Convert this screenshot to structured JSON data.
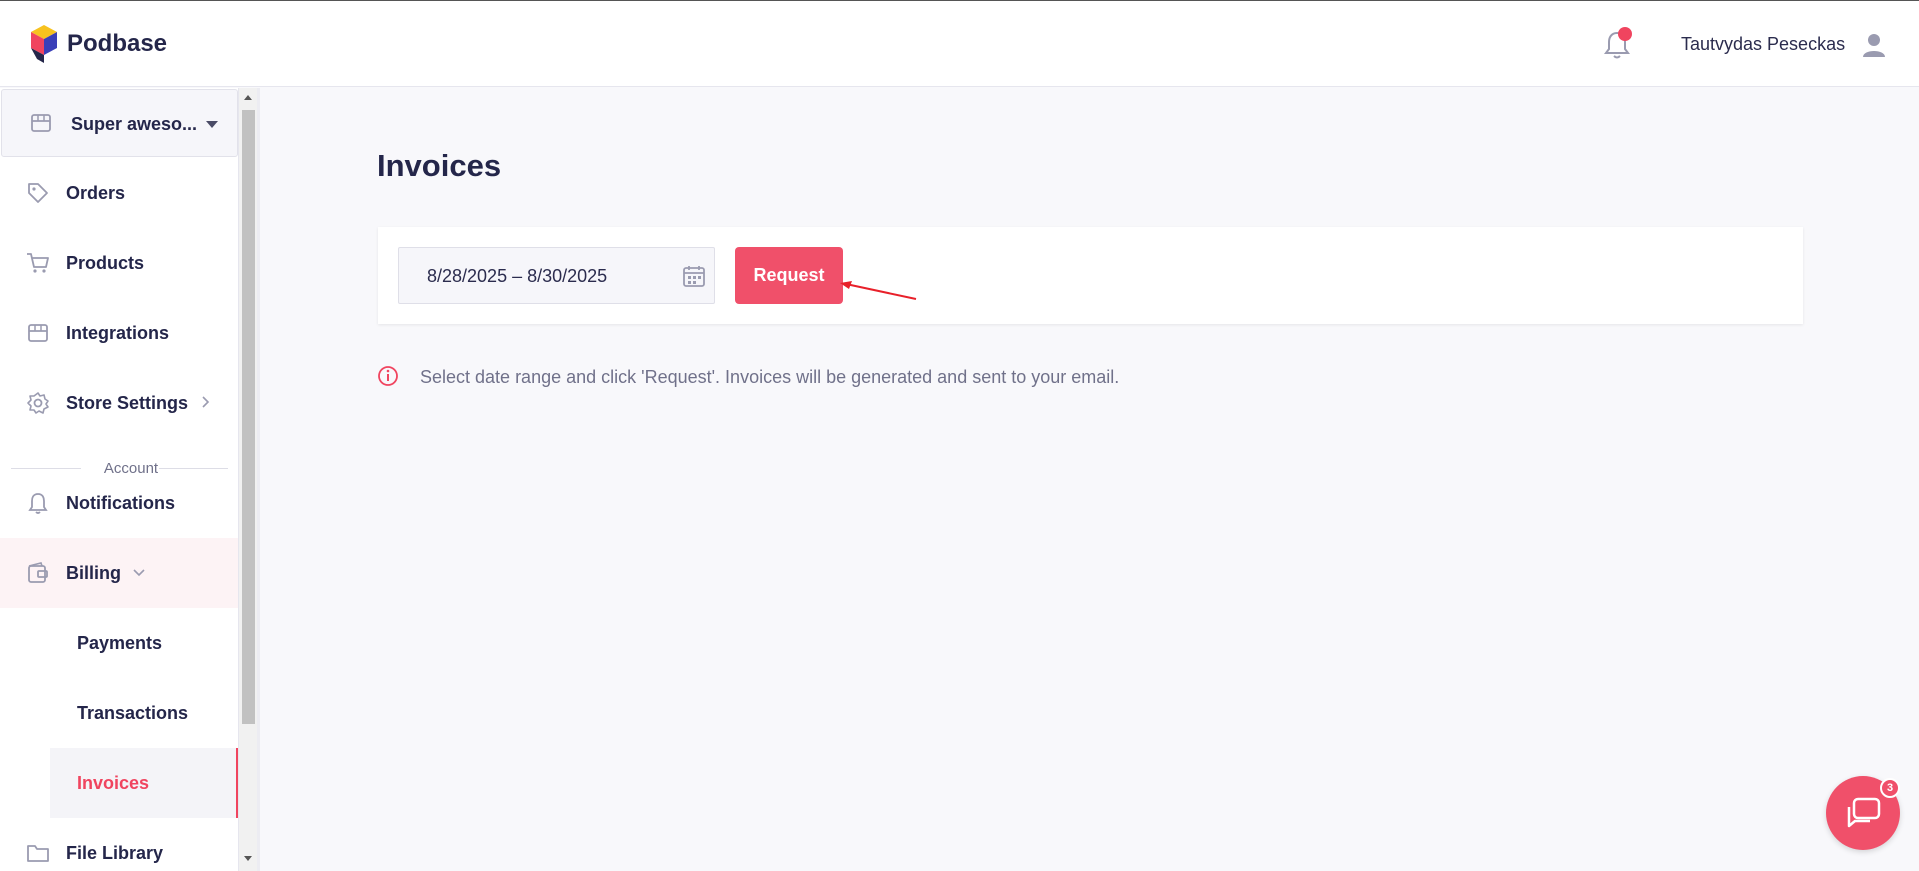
{
  "header": {
    "brand": "Podbase",
    "user_name": "Tautvydas Peseckas",
    "notification_dot": true
  },
  "sidebar": {
    "store_name": "Super aweso...",
    "items": [
      {
        "label": "Orders",
        "icon": "tag-icon"
      },
      {
        "label": "Products",
        "icon": "cart-icon"
      },
      {
        "label": "Integrations",
        "icon": "store-icon"
      },
      {
        "label": "Store Settings",
        "icon": "gear-icon"
      }
    ],
    "section_label": "Account",
    "account_items": [
      {
        "label": "Notifications",
        "icon": "bell-icon"
      },
      {
        "label": "Billing",
        "icon": "wallet-icon"
      }
    ],
    "billing_sub": [
      {
        "label": "Payments"
      },
      {
        "label": "Transactions"
      },
      {
        "label": "Invoices"
      }
    ],
    "file_library": "File Library"
  },
  "main": {
    "title": "Invoices",
    "date_range": "8/28/2025 – 8/30/2025",
    "request_label": "Request",
    "info_text": "Select date range and click 'Request'. Invoices will be generated and sent to your email."
  },
  "chat": {
    "badge": "3"
  },
  "colors": {
    "accent": "#f0506a",
    "text": "#24264a",
    "muted": "#70718a"
  }
}
